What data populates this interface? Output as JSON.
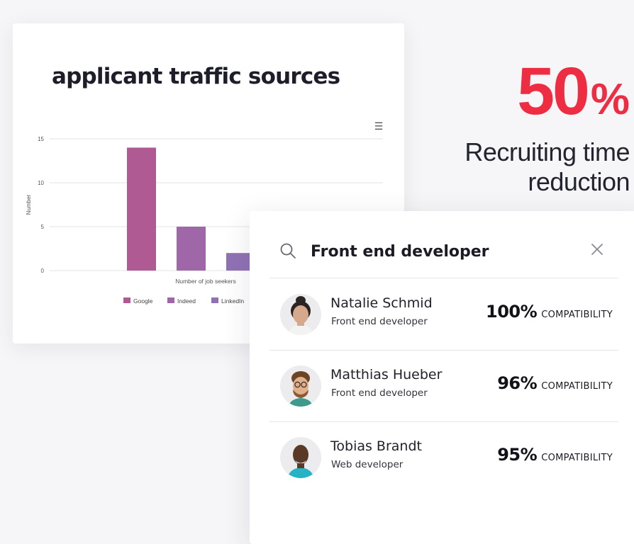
{
  "chart_data": {
    "type": "bar",
    "title": "applicant traffic sources",
    "ylabel": "Number",
    "xlabel": "Number of job seekers",
    "ylim": [
      0,
      15
    ],
    "yticks": [
      0,
      5,
      10,
      15
    ],
    "grid": true,
    "legend_position": "bottom",
    "series": [
      {
        "name": "Google",
        "values": [
          14
        ],
        "color": "#b05a94"
      },
      {
        "name": "Indeed",
        "values": [
          5
        ],
        "color": "#a067a8"
      },
      {
        "name": "LinkedIn",
        "values": [
          2
        ],
        "color": "#9072b4"
      }
    ]
  },
  "chart_menu_icon": "hamburger-menu-icon",
  "stat": {
    "value": "50",
    "unit": "%",
    "caption_line1": "Recruiting time",
    "caption_line2": "reduction",
    "color": "#ee2d43"
  },
  "search": {
    "value": "Front end developer",
    "icon": "search-icon",
    "clear_icon": "close-icon"
  },
  "results": [
    {
      "name": "Natalie Schmid",
      "role": "Front end developer",
      "percent": "100%",
      "label": "COMPATIBILITY"
    },
    {
      "name": "Matthias Hueber",
      "role": "Front end developer",
      "percent": "96%",
      "label": "COMPATIBILITY"
    },
    {
      "name": "Tobias Brandt",
      "role": "Web developer",
      "percent": "95%",
      "label": "COMPATIBILITY"
    }
  ]
}
